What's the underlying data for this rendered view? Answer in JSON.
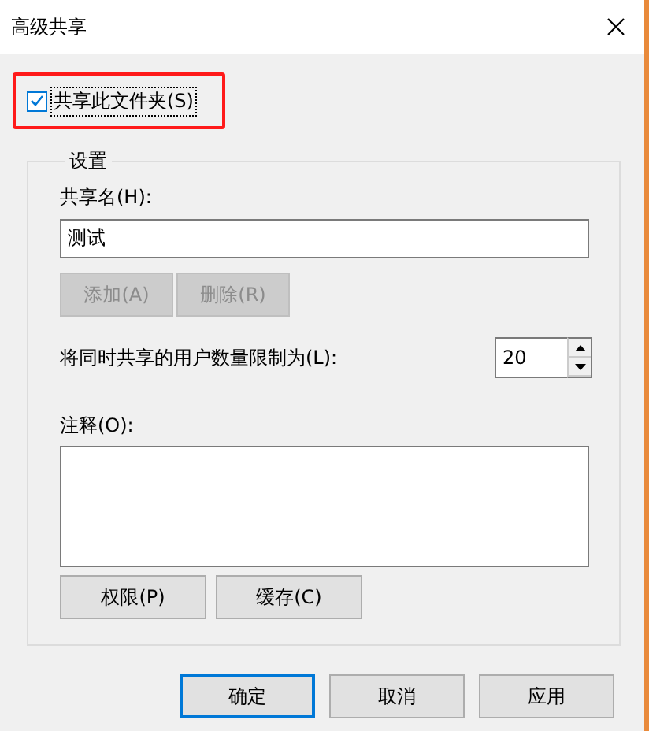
{
  "window": {
    "title": "高级共享"
  },
  "share_checkbox": {
    "label": "共享此文件夹(S)",
    "checked": true,
    "highlighted": true
  },
  "settings_group": {
    "legend": "设置",
    "share_name": {
      "label": "共享名(H):",
      "value": "测试"
    },
    "name_buttons": [
      {
        "label": "添加(A)",
        "disabled": true
      },
      {
        "label": "删除(R)",
        "disabled": true
      }
    ],
    "user_limit": {
      "label": "将同时共享的用户数量限制为(L):",
      "value": "20"
    },
    "comment": {
      "label": "注释(O):"
    },
    "buttons": [
      {
        "label": "权限(P)",
        "disabled": false
      },
      {
        "label": "缓存(C)",
        "disabled": false
      }
    ]
  },
  "footer_buttons": [
    {
      "label": "确定",
      "default": true
    },
    {
      "label": "取消",
      "default": false
    },
    {
      "label": "应用",
      "default": false
    }
  ]
}
